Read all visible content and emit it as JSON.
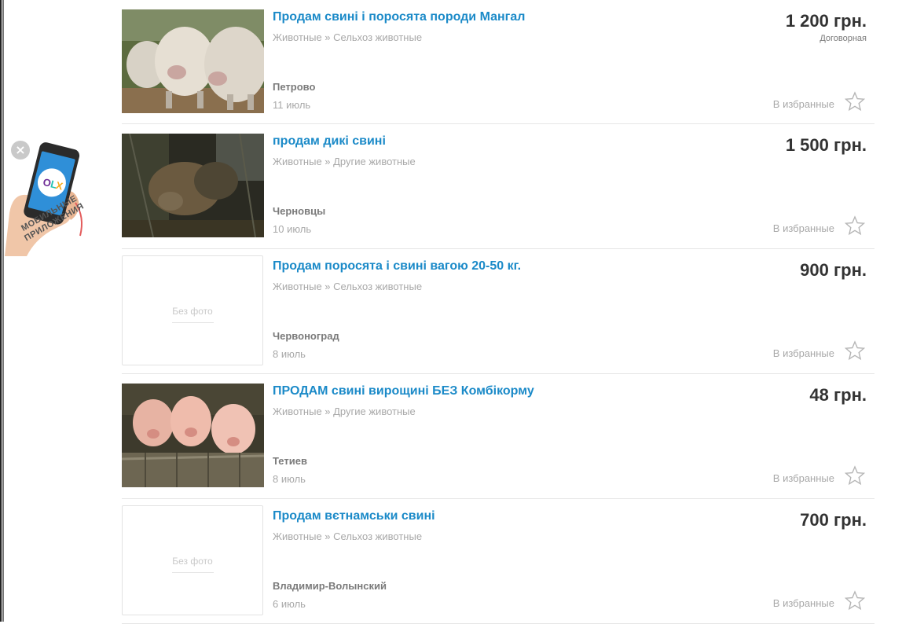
{
  "promo": {
    "line1": "МОБИЛЬНЫЕ",
    "line2": "ПРИЛОЖЕНИЯ",
    "close_symbol": "×",
    "brand_letters": [
      "O",
      "L",
      "X"
    ],
    "brand_colors": [
      "#6e2b96",
      "#23c2b3",
      "#f4ac1e"
    ]
  },
  "favorite_label": "В избранные",
  "no_photo_label": "Без фото",
  "listings": [
    {
      "title": "Продам свині і поросята породи Мангал",
      "category": "Животные » Сельхоз животные",
      "city": "Петрово",
      "date": "11 июль",
      "price": "1 200 грн.",
      "negotiable": "Договорная",
      "photo": "sheep-like-pigs"
    },
    {
      "title": "продам дикі свині",
      "category": "Животные » Другие животные",
      "city": "Черновцы",
      "date": "10 июль",
      "price": "1 500 грн.",
      "negotiable": "",
      "photo": "dark-pig"
    },
    {
      "title": "Продам поросята і свині вагою 20-50 кг.",
      "category": "Животные » Сельхоз животные",
      "city": "Червоноград",
      "date": "8 июль",
      "price": "900 грн.",
      "negotiable": "",
      "photo": ""
    },
    {
      "title": "ПРОДАМ свині вирощині БЕЗ Комбікорму",
      "category": "Животные » Другие животные",
      "city": "Тетиев",
      "date": "8 июль",
      "price": "48 грн.",
      "negotiable": "",
      "photo": "piglets-on-fence"
    },
    {
      "title": "Продам вєтнамськи свині",
      "category": "Животные » Сельхоз животные",
      "city": "Владимир-Волынский",
      "date": "6 июль",
      "price": "700 грн.",
      "negotiable": "",
      "photo": ""
    }
  ]
}
